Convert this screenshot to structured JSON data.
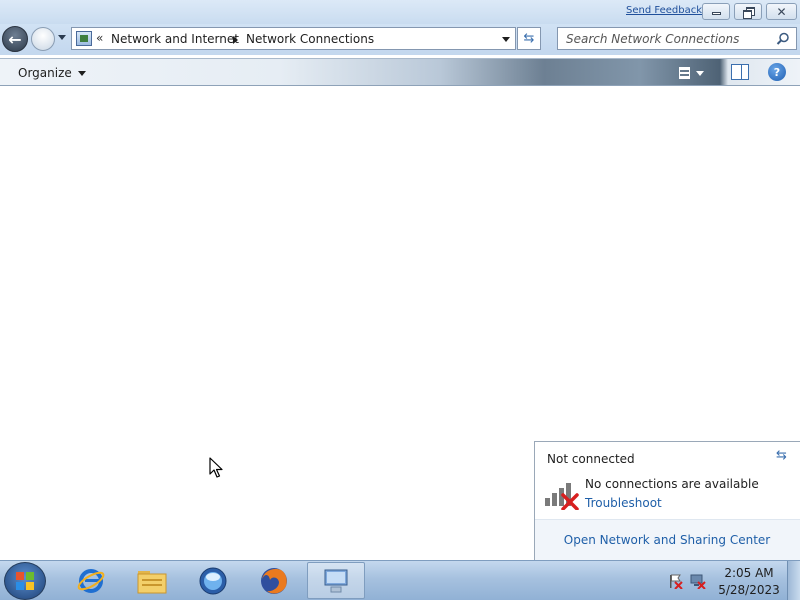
{
  "window": {
    "feedback_link": "Send Feedback",
    "controls": {
      "minimize": "minimize-icon",
      "maximize": "restore-icon",
      "close": "close-icon"
    }
  },
  "address_bar": {
    "overflow": "«",
    "breadcrumbs": [
      {
        "label": "Network and Internet"
      },
      {
        "label": "Network Connections"
      }
    ]
  },
  "search": {
    "placeholder": "Search Network Connections"
  },
  "command_bar": {
    "organize_label": "Organize"
  },
  "network_flyout": {
    "title": "Not connected",
    "message": "No connections are available",
    "troubleshoot_link": "Troubleshoot",
    "footer_link": "Open Network and Sharing Center"
  },
  "taskbar": {
    "pinned": [
      "internet-explorer-icon",
      "windows-explorer-icon",
      "windows-media-player-icon",
      "firefox-icon",
      "network-connections-icon"
    ],
    "active": "network-connections-icon"
  },
  "tray": {
    "icons": [
      "action-center-flag-icon",
      "network-disconnected-icon"
    ],
    "time": "2:05 AM",
    "date": "5/28/2023"
  },
  "colors": {
    "link": "#1f5fa8",
    "taskbar": "#a6c1df",
    "error_red": "#d71f1f"
  }
}
